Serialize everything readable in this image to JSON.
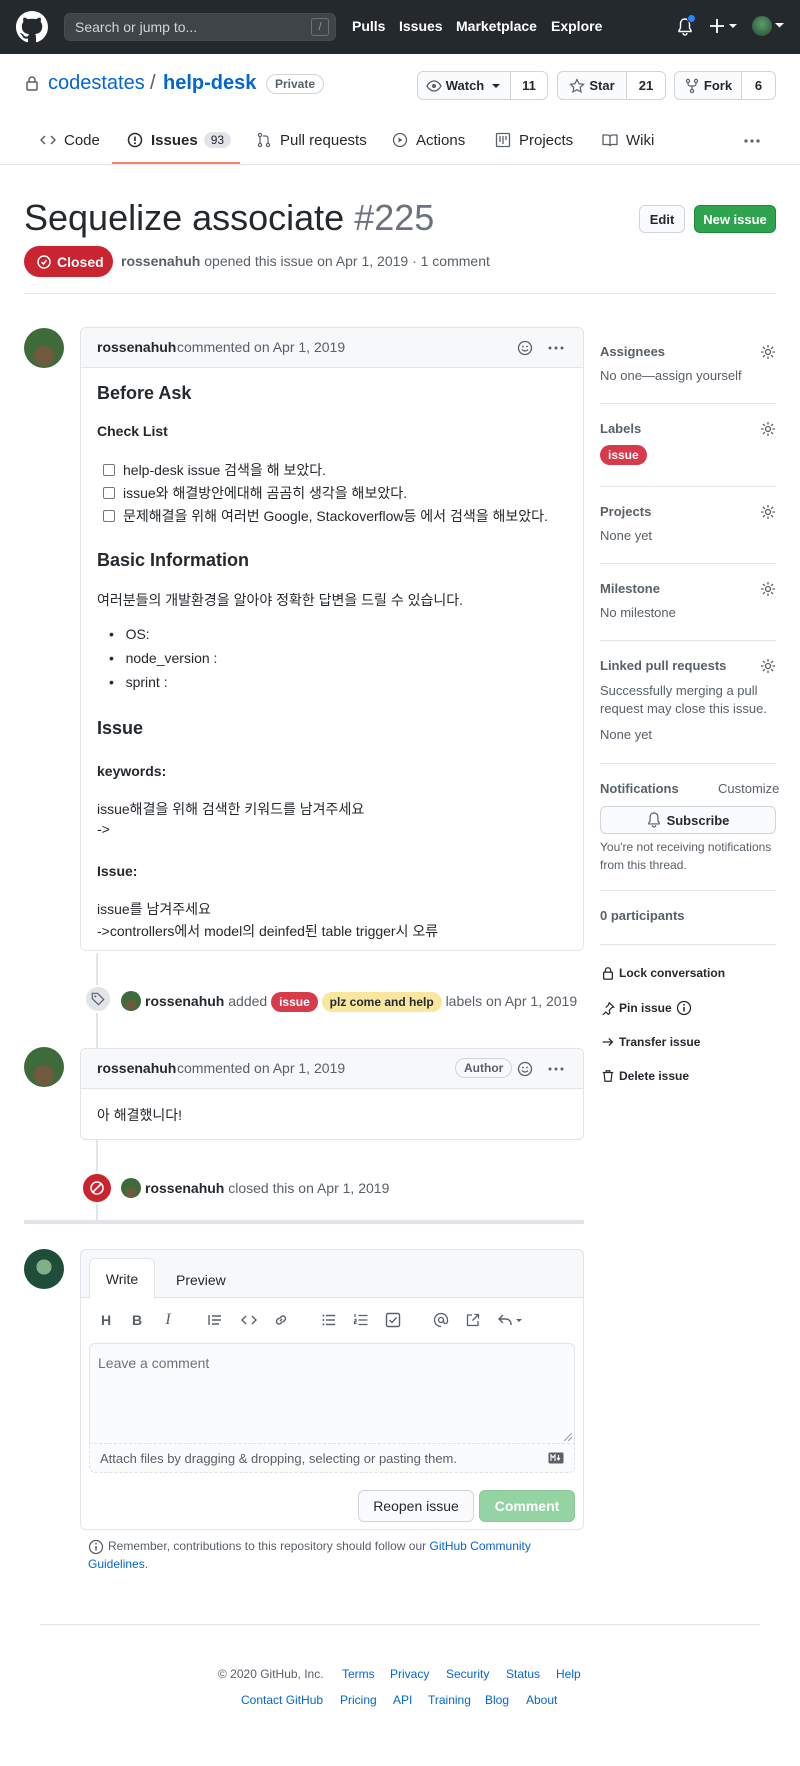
{
  "header": {
    "search_placeholder": "Search or jump to...",
    "slash_key": "/",
    "nav": [
      "Pulls",
      "Issues",
      "Marketplace",
      "Explore"
    ]
  },
  "repo": {
    "owner": "codestates",
    "separator": "/",
    "name": "help-desk",
    "visibility": "Private",
    "watch_label": "Watch",
    "watch_count": "11",
    "star_label": "Star",
    "star_count": "21",
    "fork_label": "Fork",
    "fork_count": "6"
  },
  "tabs": {
    "code": "Code",
    "issues": "Issues",
    "issues_count": "93",
    "pulls": "Pull requests",
    "actions": "Actions",
    "projects": "Projects",
    "wiki": "Wiki"
  },
  "issue": {
    "title": "Sequelize associate",
    "number": "#225",
    "edit_label": "Edit",
    "new_issue_label": "New issue",
    "state": "Closed",
    "author": "rossenahuh",
    "meta_text": "opened this issue on Apr 1, 2019 · 1 comment"
  },
  "comment1": {
    "author": "rossenahuh",
    "meta": "commented on Apr 1, 2019",
    "h_before_ask": "Before Ask",
    "h_checklist": "Check List",
    "checks": [
      "help-desk issue 검색을 해 보았다.",
      "issue와 해결방안에대해 곰곰히 생각을 해보았다.",
      "문제해결을 위해 여러번 Google, Stackoverflow등 에서 검색을 해보았다."
    ],
    "h_basic": "Basic Information",
    "basic_text": "여러분들의 개발환경을 알아야 정확한 답변을 드릴 수 있습니다.",
    "bullets": [
      "OS:",
      "node_version :",
      "sprint :"
    ],
    "h_issue": "Issue",
    "h_keywords": "keywords:",
    "keywords_line1": "issue해결을 위해 검색한 키워드를 남겨주세요",
    "keywords_line2": "->",
    "h_issue2": "Issue:",
    "issue_line1": "issue를 남겨주세요",
    "issue_line2": "->controllers에서 model의 deinfed된 table trigger시 오류"
  },
  "event_labels": {
    "author": "rossenahuh",
    "verb": "added",
    "label1": "issue",
    "label2": "plz come and help",
    "suffix": "labels on Apr 1, 2019"
  },
  "comment2": {
    "author": "rossenahuh",
    "meta": "commented on Apr 1, 2019",
    "badge": "Author",
    "body": "아 해결했니다!"
  },
  "event_closed": {
    "author": "rossenahuh",
    "text": "closed this on Apr 1, 2019"
  },
  "composer": {
    "tab_write": "Write",
    "tab_preview": "Preview",
    "placeholder": "Leave a comment",
    "attach_text": "Attach files by dragging & dropping, selecting or pasting them.",
    "reopen_label": "Reopen issue",
    "comment_label": "Comment",
    "notice_text": "Remember, contributions to this repository should follow our",
    "notice_link1": "GitHub Community",
    "notice_link2": "Guidelines",
    "notice_end": "."
  },
  "sidebar": {
    "assignees_h": "Assignees",
    "assignees_v": "No one—assign yourself",
    "labels_h": "Labels",
    "labels_v": "issue",
    "projects_h": "Projects",
    "projects_v": "None yet",
    "milestone_h": "Milestone",
    "milestone_v": "No milestone",
    "linked_h": "Linked pull requests",
    "linked_v1": "Successfully merging a pull",
    "linked_v2": "request may close this issue.",
    "linked_v3": "None yet",
    "notif_h": "Notifications",
    "customize": "Customize",
    "subscribe": "Subscribe",
    "notif_t1": "You're not receiving notifications",
    "notif_t2": "from this thread.",
    "participants": "0 participants",
    "lock": "Lock conversation",
    "pin": "Pin issue",
    "transfer": "Transfer issue",
    "delete": "Delete issue"
  },
  "footer": {
    "copyright": "© 2020 GitHub, Inc.",
    "row1": [
      "Terms",
      "Privacy",
      "Security",
      "Status",
      "Help"
    ],
    "row2": [
      "Contact GitHub",
      "Pricing",
      "API",
      "Training",
      "Blog",
      "About"
    ]
  },
  "colors": {
    "header_bg": "#24292e",
    "link": "#0366d6",
    "closed_red": "#cb2431",
    "green": "#2ea44f",
    "issue_label": "#d73a4a",
    "help_label": "#f9e79f",
    "tab_underline": "#f9826c"
  }
}
